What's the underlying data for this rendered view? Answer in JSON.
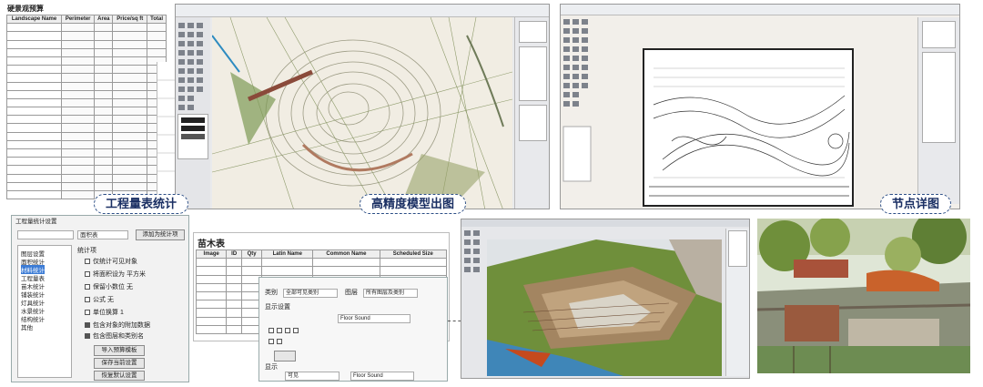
{
  "captions": {
    "quantity": "工程量表统计",
    "model": "高精度模型出图",
    "detail": "节点详图"
  },
  "sheet": {
    "title": "硬景观预算",
    "headers": [
      "Landscape Name",
      "Perimeter",
      "Area",
      "Price/sq ft",
      "Total"
    ]
  },
  "plant_table": {
    "title": "苗木表",
    "headers": [
      "Image",
      "ID",
      "Qty",
      "Latin Name",
      "Common Name",
      "Scheduled Size"
    ]
  },
  "settings_dialog": {
    "title": "工程量统计设置",
    "dropdown_value": "面积表",
    "dropdown_button": "添加为统计项",
    "tree_items": [
      "图层设置",
      "面积统计",
      "材料统计",
      "工程量表",
      "苗木统计",
      "铺装统计",
      "灯具统计",
      "水景统计",
      "结构统计",
      "其他"
    ],
    "section_label": "统计项",
    "options": [
      {
        "label": "仅统计可见对象",
        "checked": false
      },
      {
        "label": "将面积设为 平方米",
        "checked": false
      },
      {
        "label": "保留小数位 无",
        "checked": false
      },
      {
        "label": "公式 无",
        "checked": false
      },
      {
        "label": "单位换算 1",
        "checked": false
      },
      {
        "label": "包含对象的附加数据",
        "checked": true
      },
      {
        "label": "包含图层和类别名",
        "checked": true
      }
    ],
    "buttons": [
      "导入预算模板",
      "保存当前设置",
      "恢复默认设置"
    ]
  },
  "overlay_dialog": {
    "label1": "类别",
    "value1": "全部可见类别",
    "label2": "图层",
    "value2": "所有图层及类别",
    "floor": "Floor Sound",
    "section": "显示设置",
    "bottom_label": "显示",
    "bottom_value": "Floor Sound",
    "bottom_select": "可见"
  }
}
